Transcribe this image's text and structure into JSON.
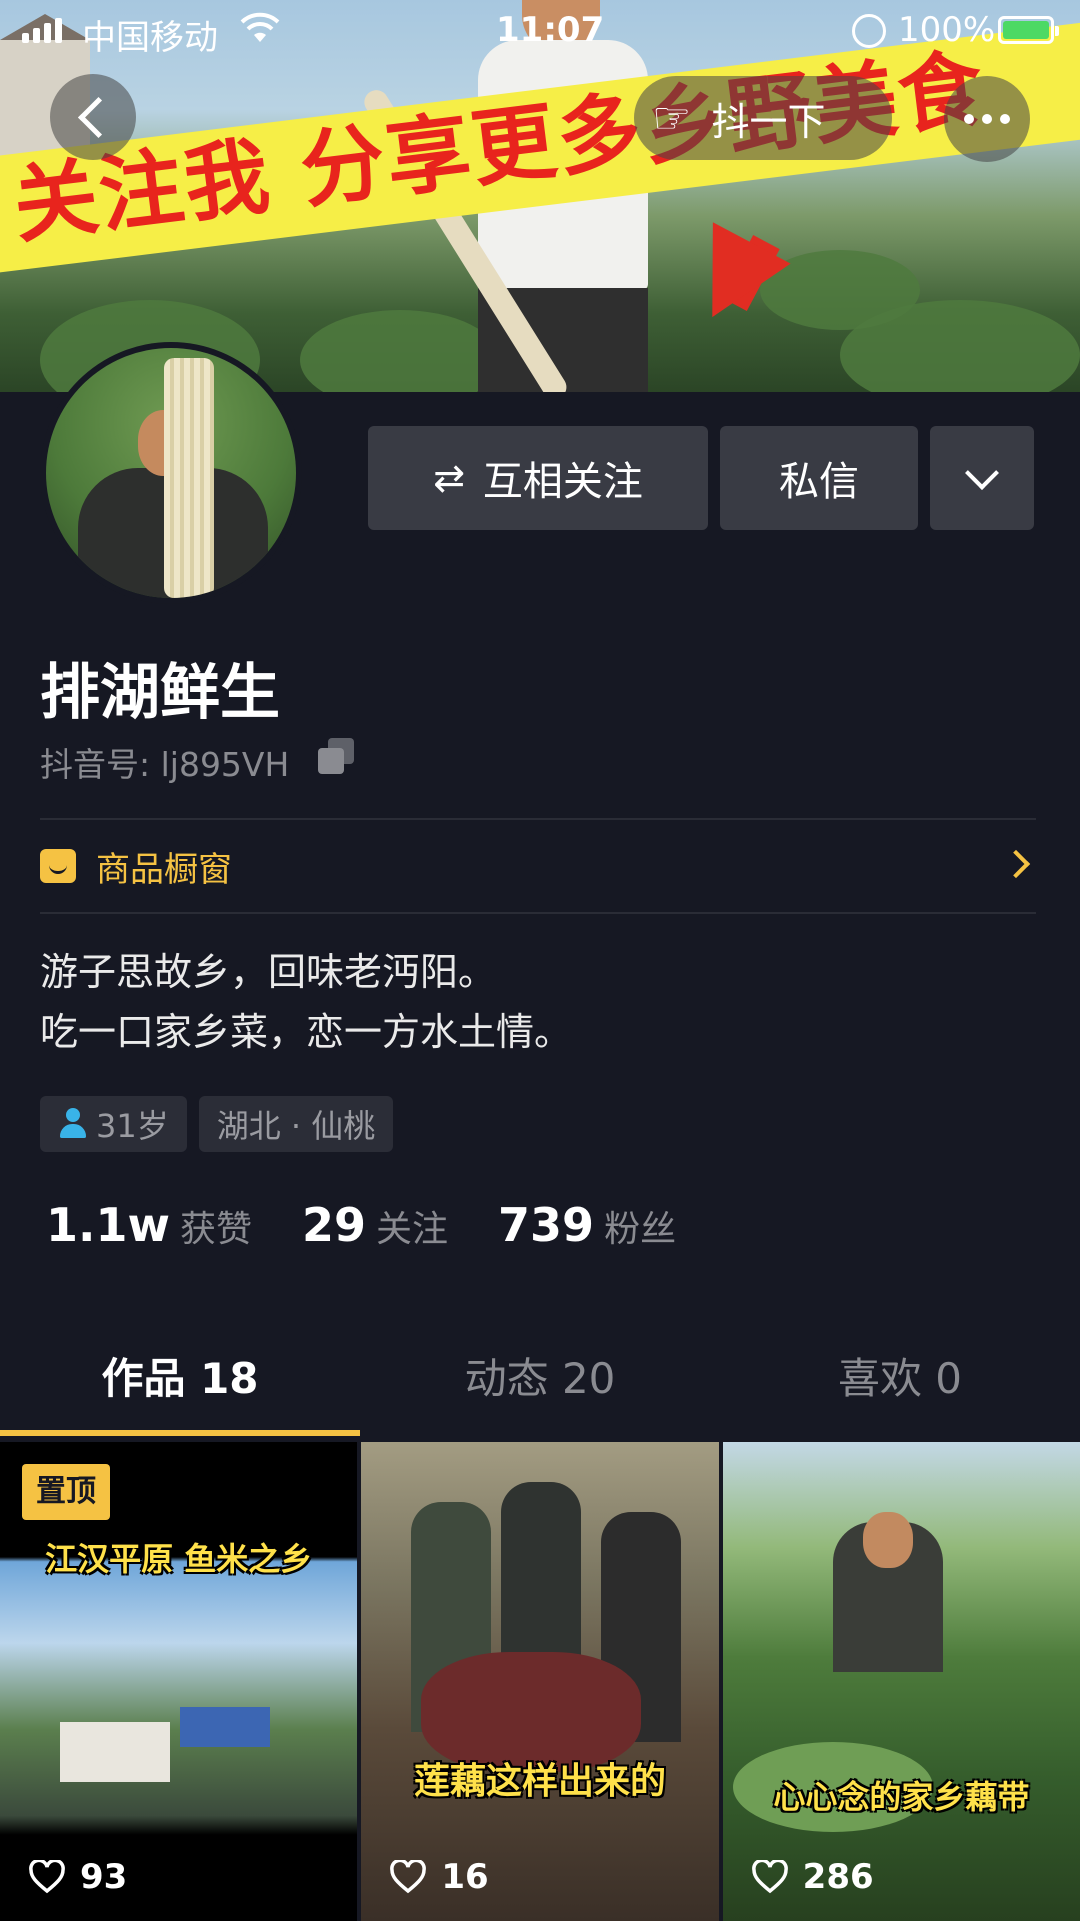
{
  "status_bar": {
    "carrier": "中国移动",
    "time": "11:07",
    "battery": "100%"
  },
  "banner": {
    "slogan": "关注我 分享更多乡野美食"
  },
  "top_bar": {
    "shake_label": "抖一下"
  },
  "actions": {
    "mutual_follow": "互相关注",
    "message": "私信"
  },
  "profile": {
    "name": "排湖鲜生",
    "douyin_id": "抖音号: lj895VH",
    "shop_label": "商品橱窗",
    "bio": [
      "游子思故乡，回味老沔阳。",
      "吃一口家乡菜，恋一方水土情。"
    ],
    "tags": {
      "age": "31岁",
      "location": "湖北 · 仙桃"
    }
  },
  "stats": {
    "likes": {
      "value": "1.1w",
      "label": "获赞"
    },
    "following": {
      "value": "29",
      "label": "关注"
    },
    "followers": {
      "value": "739",
      "label": "粉丝"
    }
  },
  "tabs": [
    {
      "label": "作品 18"
    },
    {
      "label": "动态 20"
    },
    {
      "label": "喜欢 0"
    }
  ],
  "videos": [
    {
      "pinned": "置顶",
      "caption": "江汉平原 鱼米之乡",
      "likes": "93"
    },
    {
      "caption": "莲藕这样出来的",
      "likes": "16"
    },
    {
      "caption": "心心念的家乡藕带",
      "likes": "286"
    }
  ],
  "colors": {
    "accent": "#f5c243",
    "background": "#161823",
    "button": "#393b44"
  }
}
